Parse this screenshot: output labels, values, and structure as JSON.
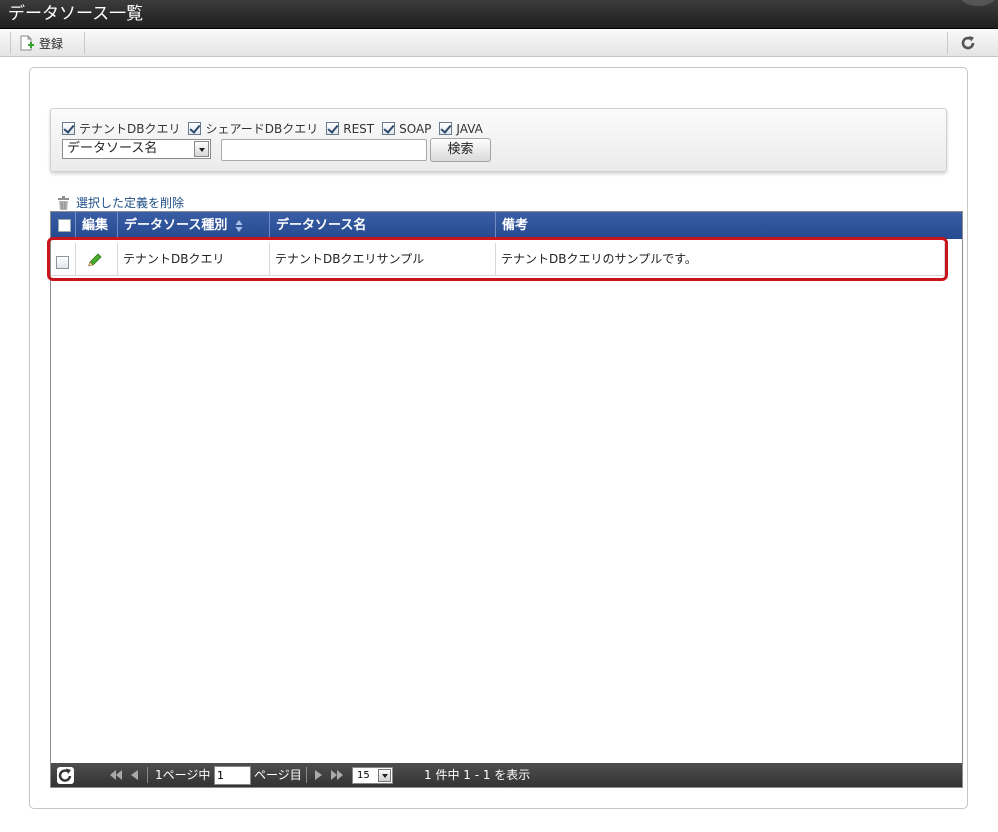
{
  "window": {
    "title": "データソース一覧"
  },
  "toolbar": {
    "register_label": "登録"
  },
  "search": {
    "filters": [
      {
        "label": "テナントDBクエリ",
        "checked": true
      },
      {
        "label": "シェアードDBクエリ",
        "checked": true
      },
      {
        "label": "REST",
        "checked": true
      },
      {
        "label": "SOAP",
        "checked": true
      },
      {
        "label": "JAVA",
        "checked": true
      }
    ],
    "field_select": "データソース名",
    "keyword": "",
    "button_label": "検索"
  },
  "delete_selected_label": "選択した定義を削除",
  "grid": {
    "columns": {
      "edit": "編集",
      "type": "データソース種別",
      "name": "データソース名",
      "note": "備考"
    },
    "rows": [
      {
        "type": "テナントDBクエリ",
        "name": "テナントDBクエリサンプル",
        "note": "テナントDBクエリのサンプルです。"
      }
    ]
  },
  "pager": {
    "page_prefix": "1ページ中",
    "page_value": "1",
    "page_suffix": "ページ目",
    "page_size": "15",
    "summary": "1 件中 1 - 1 を表示"
  },
  "colors": {
    "header_blue": "#2f549c",
    "highlight_red": "#c8141c",
    "pager_dark": "#3b3b3b"
  }
}
